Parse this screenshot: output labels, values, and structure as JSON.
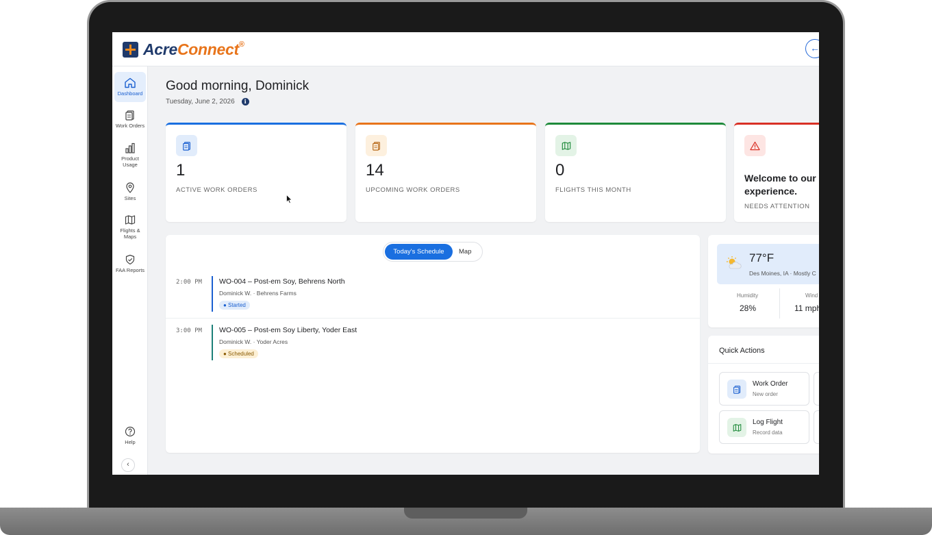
{
  "app": {
    "logo_primary": "Acre",
    "logo_secondary": "Connect",
    "logo_reg": "®",
    "topbar_button_icon": "←"
  },
  "sidebar": {
    "items": [
      {
        "label": "Dashboard",
        "icon": "home-icon",
        "active": true
      },
      {
        "label": "Work Orders",
        "icon": "clipboard-icon"
      },
      {
        "label": "Product Usage",
        "icon": "bar-chart-icon"
      },
      {
        "label": "Sites",
        "icon": "map-pin-icon"
      },
      {
        "label": "Flights & Maps",
        "icon": "map-icon"
      },
      {
        "label": "FAA Reports",
        "icon": "shield-check-icon"
      }
    ],
    "help_label": "Help",
    "collapse_icon": "‹"
  },
  "header": {
    "greeting": "Good morning, Dominick",
    "date": "Tuesday, June 2, 2026",
    "info_icon": "i"
  },
  "stats": [
    {
      "value": "1",
      "label": "ACTIVE WORK ORDERS",
      "accent": "#1a6fe0",
      "icon_bg": "#e1ecfb",
      "icon": "clipboard-icon"
    },
    {
      "value": "14",
      "label": "UPCOMING WORK ORDERS",
      "accent": "#e8741a",
      "icon_bg": "#fdf0de",
      "icon": "clipboard-icon"
    },
    {
      "value": "0",
      "label": "FLIGHTS THIS MONTH",
      "accent": "#1e8a3a",
      "icon_bg": "#e3f3e6",
      "icon": "map-icon"
    },
    {
      "title_line1": "Welcome to our",
      "title_line2": "experience.",
      "label": "NEEDS ATTENTION",
      "accent": "#d93025",
      "icon_bg": "#fde5e3",
      "icon": "warning-icon"
    }
  ],
  "schedule": {
    "tabs": [
      {
        "label": "Today's Schedule",
        "active": true
      },
      {
        "label": "Map",
        "active": false
      }
    ],
    "items": [
      {
        "time": "2:00 PM",
        "title": "WO-004 – Post-em Soy, Behrens North",
        "sub": "Dominick W. · Behrens Farms",
        "status": "● Started",
        "bar_color": "#1a5fd0",
        "badge_bg": "#e1ecfb",
        "badge_color": "#1a5fd0"
      },
      {
        "time": "3:00 PM",
        "title": "WO-005 – Post-em Soy Liberty, Yoder East",
        "sub": "Dominick W. · Yoder Acres",
        "status": "● Scheduled",
        "bar_color": "#1b7f78",
        "badge_bg": "#fdf0d5",
        "badge_color": "#8a5a00"
      }
    ]
  },
  "weather": {
    "temp": "77°F",
    "location": "Des Moines, IA · Mostly C",
    "humidity_label": "Humidity",
    "humidity_value": "28%",
    "wind_label": "Wind",
    "wind_value": "11 mph",
    "icon": "partly-sunny-icon"
  },
  "quick_actions": {
    "title": "Quick Actions",
    "items": [
      {
        "label": "Work Order",
        "sub": "New order",
        "icon": "clipboard-icon",
        "icon_bg": "#e1ecfb"
      },
      {
        "label": "Log Flight",
        "sub": "Record data",
        "icon": "map-icon",
        "icon_bg": "#e3f3e6"
      }
    ]
  }
}
